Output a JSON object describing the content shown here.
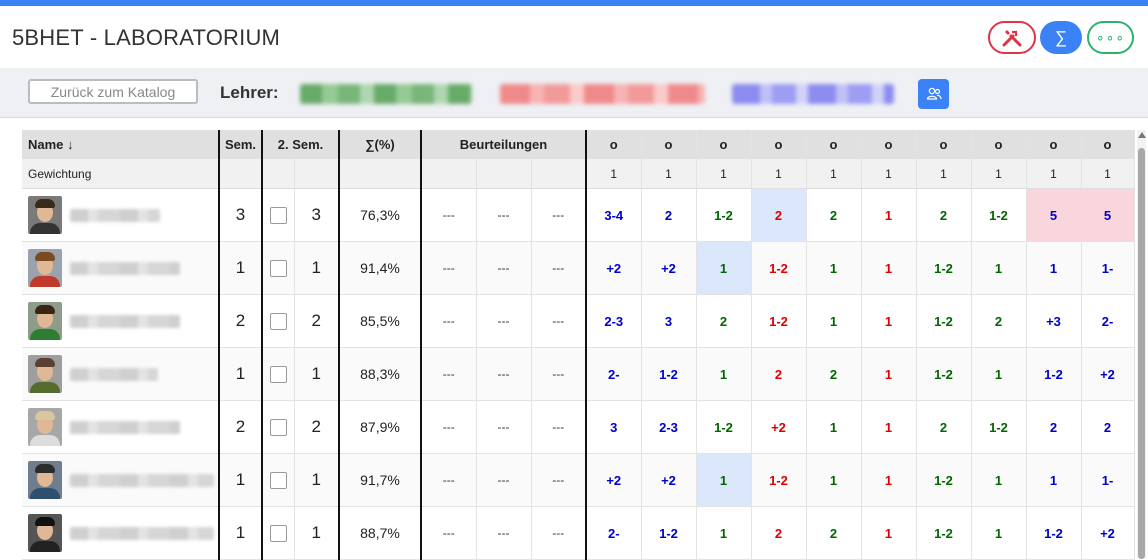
{
  "app": {
    "title": "5BHET - LABORATORIUM"
  },
  "header_buttons": {
    "tools_icon": "tools-icon",
    "sum_symbol": "∑",
    "more_symbol": "∘∘∘",
    "colors": {
      "tools": "#dc3545",
      "sum": "#3b82f6",
      "more": "#2cb36b"
    }
  },
  "toolbar": {
    "back_label": "Zurück zum Katalog",
    "teacher_label": "Lehrer:",
    "people_icon": "people-icon"
  },
  "table": {
    "headers": {
      "name": "Name ↓",
      "sem1": "Sem.",
      "sem2": "2. Sem.",
      "sum": "∑(%)",
      "beurteilungen": "Beurteilungen",
      "grade_cols": [
        "o",
        "o",
        "o",
        "o",
        "o",
        "o",
        "o",
        "o",
        "o",
        "o"
      ]
    },
    "weight_row": {
      "label": "Gewichtung",
      "weights": [
        "1",
        "1",
        "1",
        "1",
        "1",
        "1",
        "1",
        "1",
        "1",
        "1"
      ]
    },
    "rows": [
      {
        "sem1": "3",
        "sem2": "3",
        "pct": "76,3%",
        "beurteilungen": [
          "---",
          "---",
          "---"
        ],
        "grades": [
          {
            "v": "3-4",
            "c": "blue"
          },
          {
            "v": "2",
            "c": "blue"
          },
          {
            "v": "1-2",
            "c": "green"
          },
          {
            "v": "2",
            "c": "red",
            "hl": "blue"
          },
          {
            "v": "2",
            "c": "green"
          },
          {
            "v": "1",
            "c": "red"
          },
          {
            "v": "2",
            "c": "green"
          },
          {
            "v": "1-2",
            "c": "green"
          },
          {
            "v": "5",
            "c": "blue",
            "hl": "pink"
          },
          {
            "v": "5",
            "c": "blue",
            "hl": "pink"
          }
        ]
      },
      {
        "sem1": "1",
        "sem2": "1",
        "pct": "91,4%",
        "beurteilungen": [
          "---",
          "---",
          "---"
        ],
        "grades": [
          {
            "v": "+2",
            "c": "blue"
          },
          {
            "v": "+2",
            "c": "blue"
          },
          {
            "v": "1",
            "c": "green",
            "hl": "blue"
          },
          {
            "v": "1-2",
            "c": "red"
          },
          {
            "v": "1",
            "c": "green"
          },
          {
            "v": "1",
            "c": "red"
          },
          {
            "v": "1-2",
            "c": "green"
          },
          {
            "v": "1",
            "c": "green"
          },
          {
            "v": "1",
            "c": "blue"
          },
          {
            "v": "1-",
            "c": "blue"
          }
        ]
      },
      {
        "sem1": "2",
        "sem2": "2",
        "pct": "85,5%",
        "beurteilungen": [
          "---",
          "---",
          "---"
        ],
        "grades": [
          {
            "v": "2-3",
            "c": "blue"
          },
          {
            "v": "3",
            "c": "blue"
          },
          {
            "v": "2",
            "c": "green"
          },
          {
            "v": "1-2",
            "c": "red"
          },
          {
            "v": "1",
            "c": "green"
          },
          {
            "v": "1",
            "c": "red"
          },
          {
            "v": "1-2",
            "c": "green"
          },
          {
            "v": "2",
            "c": "green"
          },
          {
            "v": "+3",
            "c": "blue"
          },
          {
            "v": "2-",
            "c": "blue"
          }
        ]
      },
      {
        "sem1": "1",
        "sem2": "1",
        "pct": "88,3%",
        "beurteilungen": [
          "---",
          "---",
          "---"
        ],
        "grades": [
          {
            "v": "2-",
            "c": "blue"
          },
          {
            "v": "1-2",
            "c": "blue"
          },
          {
            "v": "1",
            "c": "green"
          },
          {
            "v": "2",
            "c": "red"
          },
          {
            "v": "2",
            "c": "green"
          },
          {
            "v": "1",
            "c": "red"
          },
          {
            "v": "1-2",
            "c": "green"
          },
          {
            "v": "1",
            "c": "green"
          },
          {
            "v": "1-2",
            "c": "blue"
          },
          {
            "v": "+2",
            "c": "blue"
          }
        ]
      },
      {
        "sem1": "2",
        "sem2": "2",
        "pct": "87,9%",
        "beurteilungen": [
          "---",
          "---",
          "---"
        ],
        "grades": [
          {
            "v": "3",
            "c": "blue"
          },
          {
            "v": "2-3",
            "c": "blue"
          },
          {
            "v": "1-2",
            "c": "green"
          },
          {
            "v": "+2",
            "c": "red"
          },
          {
            "v": "1",
            "c": "green"
          },
          {
            "v": "1",
            "c": "red"
          },
          {
            "v": "2",
            "c": "green"
          },
          {
            "v": "1-2",
            "c": "green"
          },
          {
            "v": "2",
            "c": "blue"
          },
          {
            "v": "2",
            "c": "blue"
          }
        ]
      },
      {
        "sem1": "1",
        "sem2": "1",
        "pct": "91,7%",
        "beurteilungen": [
          "---",
          "---",
          "---"
        ],
        "grades": [
          {
            "v": "+2",
            "c": "blue"
          },
          {
            "v": "+2",
            "c": "blue"
          },
          {
            "v": "1",
            "c": "green",
            "hl": "blue"
          },
          {
            "v": "1-2",
            "c": "red"
          },
          {
            "v": "1",
            "c": "green"
          },
          {
            "v": "1",
            "c": "red"
          },
          {
            "v": "1-2",
            "c": "green"
          },
          {
            "v": "1",
            "c": "green"
          },
          {
            "v": "1",
            "c": "blue"
          },
          {
            "v": "1-",
            "c": "blue"
          }
        ]
      },
      {
        "sem1": "1",
        "sem2": "1",
        "pct": "88,7%",
        "beurteilungen": [
          "---",
          "---",
          "---"
        ],
        "grades": [
          {
            "v": "2-",
            "c": "blue"
          },
          {
            "v": "1-2",
            "c": "blue"
          },
          {
            "v": "1",
            "c": "green"
          },
          {
            "v": "2",
            "c": "red"
          },
          {
            "v": "2",
            "c": "green"
          },
          {
            "v": "1",
            "c": "red"
          },
          {
            "v": "1-2",
            "c": "green"
          },
          {
            "v": "1",
            "c": "green"
          },
          {
            "v": "1-2",
            "c": "blue"
          },
          {
            "v": "+2",
            "c": "blue"
          }
        ]
      }
    ]
  },
  "colors": {
    "accent": "#3b82f6",
    "grade_blue": "#0000cc",
    "grade_green": "#006600",
    "grade_red": "#e00000",
    "highlight_blue": "#dbe7fb",
    "highlight_pink": "#f8d6dc"
  }
}
